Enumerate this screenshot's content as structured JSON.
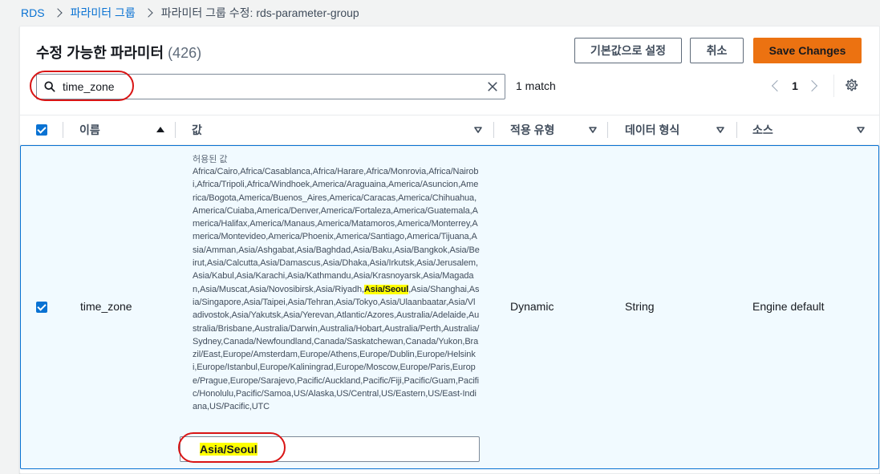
{
  "breadcrumb": {
    "root": "RDS",
    "parent": "파라미터 그룹",
    "current": "파라미터 그룹 수정: rds-parameter-group"
  },
  "header": {
    "title": "수정 가능한 파라미터",
    "count": "(426)",
    "reset_label": "기본값으로 설정",
    "cancel_label": "취소",
    "save_label": "Save Changes"
  },
  "search": {
    "value": "time_zone",
    "match_text": "1 match"
  },
  "pagination": {
    "current_page": "1"
  },
  "table": {
    "columns": [
      "이름",
      "값",
      "적용 유형",
      "데이터 형식",
      "소스"
    ],
    "rows": [
      {
        "name": "time_zone",
        "allowed_label": "허용된 값",
        "allowed_before": "Africa/Cairo,Africa/Casablanca,Africa/Harare,Africa/Monrovia,Africa/Nairobi,Africa/Tripoli,Africa/Windhoek,America/Araguaina,America/Asuncion,America/Bogota,America/Buenos_Aires,America/Caracas,America/Chihuahua,America/Cuiaba,America/Denver,America/Fortaleza,America/Guatemala,America/Halifax,America/Manaus,America/Matamoros,America/Monterrey,America/Montevideo,America/Phoenix,America/Santiago,America/Tijuana,Asia/Amman,Asia/Ashgabat,Asia/Baghdad,Asia/Baku,Asia/Bangkok,Asia/Beirut,Asia/Calcutta,Asia/Damascus,Asia/Dhaka,Asia/Irkutsk,Asia/Jerusalem,Asia/Kabul,Asia/Karachi,Asia/Kathmandu,Asia/Krasnoyarsk,Asia/Magadan,Asia/Muscat,Asia/Novosibirsk,Asia/Riyadh,",
        "allowed_highlight": "Asia/Seoul",
        "allowed_after": ",Asia/Shanghai,Asia/Singapore,Asia/Taipei,Asia/Tehran,Asia/Tokyo,Asia/Ulaanbaatar,Asia/Vladivostok,Asia/Yakutsk,Asia/Yerevan,Atlantic/Azores,Australia/Adelaide,Australia/Brisbane,Australia/Darwin,Australia/Hobart,Australia/Perth,Australia/Sydney,Canada/Newfoundland,Canada/Saskatchewan,Canada/Yukon,Brazil/East,Europe/Amsterdam,Europe/Athens,Europe/Dublin,Europe/Helsinki,Europe/Istanbul,Europe/Kaliningrad,Europe/Moscow,Europe/Paris,Europe/Prague,Europe/Sarajevo,Pacific/Auckland,Pacific/Fiji,Pacific/Guam,Pacific/Honolulu,Pacific/Samoa,US/Alaska,US/Central,US/Eastern,US/East-Indiana,US/Pacific,UTC",
        "value": "Asia/Seoul",
        "apply_type": "Dynamic",
        "data_type": "String",
        "source": "Engine default"
      }
    ]
  },
  "colors": {
    "accent": "#0972d3",
    "primary_button": "#ec7211",
    "highlight": "#ffff00",
    "annotation": "#d91515"
  },
  "icons": [
    "chevron-right-icon",
    "search-icon",
    "close-icon",
    "chevron-left-icon",
    "gear-icon",
    "sort-ascending-icon",
    "sort-descending-icon",
    "checkbox-checked-icon"
  ]
}
